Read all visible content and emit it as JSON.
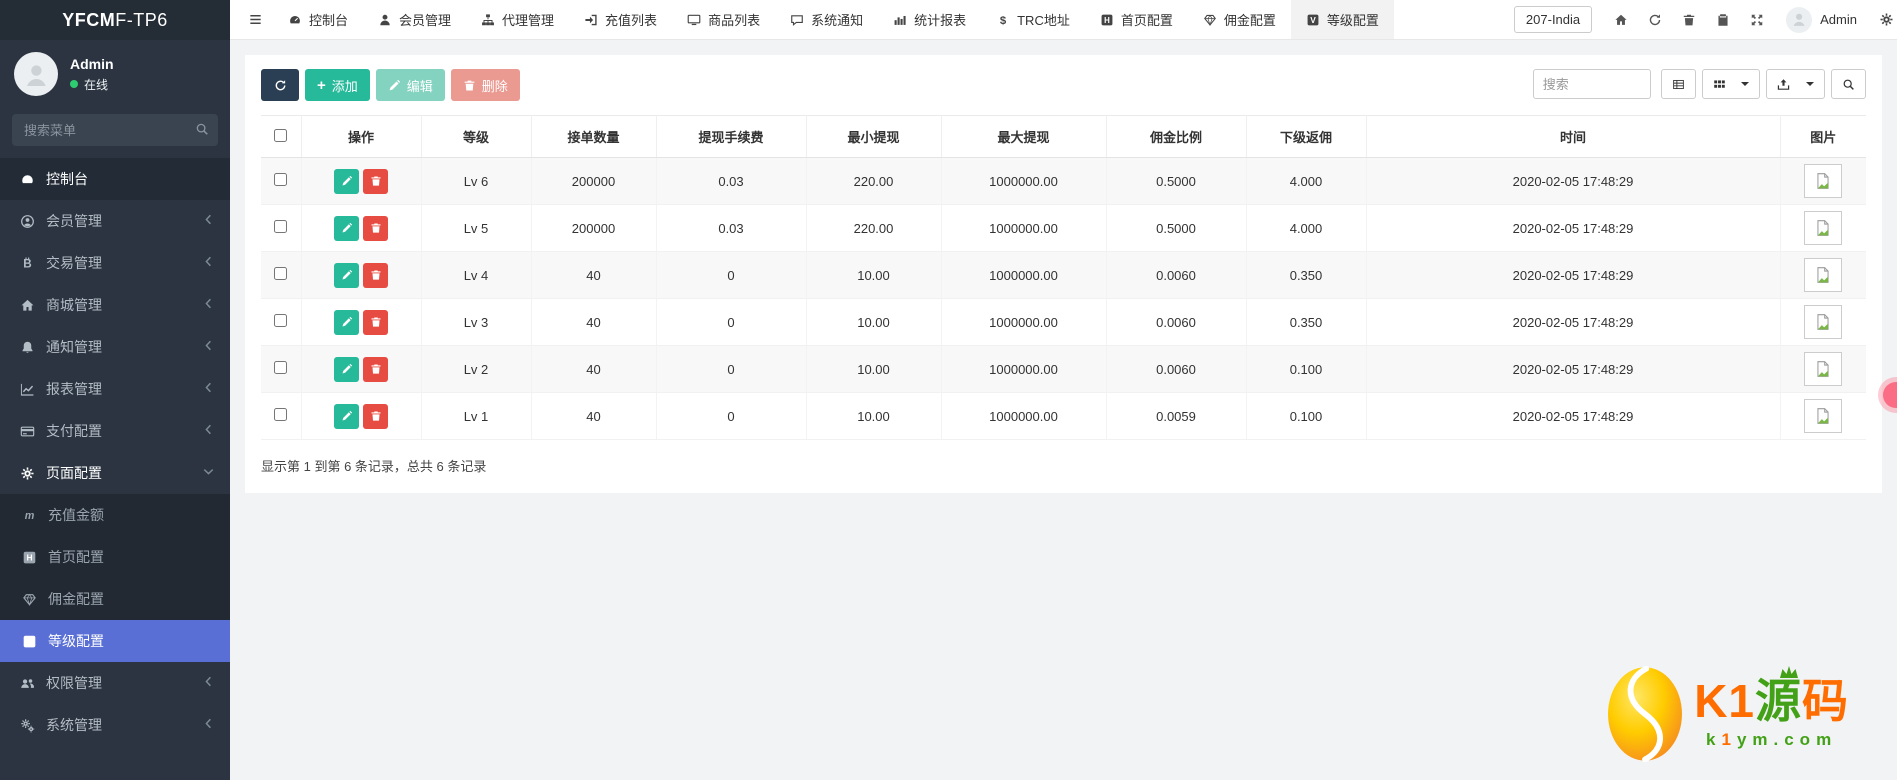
{
  "sidebar": {
    "logo_bold": "YFCM",
    "logo_light": "F-TP6",
    "user_name": "Admin",
    "user_status": "在线",
    "search_placeholder": "搜索菜单",
    "menu": [
      {
        "icon": "dashboard-icon",
        "label": "控制台",
        "state": "hover"
      },
      {
        "icon": "user-circle-icon",
        "label": "会员管理",
        "chevron": true
      },
      {
        "icon": "bitcoin-icon",
        "label": "交易管理",
        "chevron": true
      },
      {
        "icon": "home-icon",
        "label": "商城管理",
        "chevron": true
      },
      {
        "icon": "bell-icon",
        "label": "通知管理",
        "chevron": true
      },
      {
        "icon": "chart-line-icon",
        "label": "报表管理",
        "chevron": true
      },
      {
        "icon": "credit-card-icon",
        "label": "支付配置",
        "chevron": true
      },
      {
        "icon": "gear-icon",
        "label": "页面配置",
        "state": "open",
        "children": [
          {
            "icon": "monero-icon",
            "label": "充值金额"
          },
          {
            "icon": "h-square-icon",
            "label": "首页配置"
          },
          {
            "icon": "gem-icon",
            "label": "佣金配置"
          },
          {
            "icon": "v-square-icon",
            "label": "等级配置",
            "state": "active"
          }
        ]
      },
      {
        "icon": "users-icon",
        "label": "权限管理",
        "chevron": true
      },
      {
        "icon": "cogs-icon",
        "label": "系统管理",
        "chevron": true
      }
    ]
  },
  "navbar": {
    "tabs": [
      {
        "icon": "dashboard-icon",
        "label": "控制台"
      },
      {
        "icon": "user-icon",
        "label": "会员管理"
      },
      {
        "icon": "sitemap-icon",
        "label": "代理管理"
      },
      {
        "icon": "sign-in-icon",
        "label": "充值列表"
      },
      {
        "icon": "desktop-icon",
        "label": "商品列表"
      },
      {
        "icon": "comment-icon",
        "label": "系统通知"
      },
      {
        "icon": "bar-chart-icon",
        "label": "统计报表"
      },
      {
        "icon": "dollar-icon",
        "label": "TRC地址"
      },
      {
        "icon": "h-square-icon",
        "label": "首页配置"
      },
      {
        "icon": "gem-icon",
        "label": "佣金配置"
      },
      {
        "icon": "v-square-icon",
        "label": "等级配置",
        "active": true
      }
    ],
    "locale_label": "207-India",
    "right_icons": [
      "home-icon",
      "refresh-icon",
      "trash-icon",
      "copy-icon",
      "expand-icon"
    ],
    "user_name": "Admin"
  },
  "toolbar": {
    "add_label": "添加",
    "edit_label": "编辑",
    "delete_label": "删除",
    "search_placeholder": "搜索"
  },
  "table": {
    "columns": [
      "操作",
      "等级",
      "接单数量",
      "提现手续费",
      "最小提现",
      "最大提现",
      "佣金比例",
      "下级返佣",
      "时间",
      "图片"
    ],
    "rows": [
      {
        "level": "Lv 6",
        "orders": "200000",
        "fee": "0.03",
        "min": "220.00",
        "max": "1000000.00",
        "ratio": "0.5000",
        "sub": "4.000",
        "time": "2020-02-05 17:48:29"
      },
      {
        "level": "Lv 5",
        "orders": "200000",
        "fee": "0.03",
        "min": "220.00",
        "max": "1000000.00",
        "ratio": "0.5000",
        "sub": "4.000",
        "time": "2020-02-05 17:48:29"
      },
      {
        "level": "Lv 4",
        "orders": "40",
        "fee": "0",
        "min": "10.00",
        "max": "1000000.00",
        "ratio": "0.0060",
        "sub": "0.350",
        "time": "2020-02-05 17:48:29"
      },
      {
        "level": "Lv 3",
        "orders": "40",
        "fee": "0",
        "min": "10.00",
        "max": "1000000.00",
        "ratio": "0.0060",
        "sub": "0.350",
        "time": "2020-02-05 17:48:29"
      },
      {
        "level": "Lv 2",
        "orders": "40",
        "fee": "0",
        "min": "10.00",
        "max": "1000000.00",
        "ratio": "0.0060",
        "sub": "0.100",
        "time": "2020-02-05 17:48:29"
      },
      {
        "level": "Lv 1",
        "orders": "40",
        "fee": "0",
        "min": "10.00",
        "max": "1000000.00",
        "ratio": "0.0059",
        "sub": "0.100",
        "time": "2020-02-05 17:48:29"
      }
    ],
    "summary": "显示第 1 到第 6 条记录，总共 6 条记录"
  },
  "watermark": {
    "brand_part1": "K1",
    "brand_part2": "源",
    "brand_part3": "码",
    "domain_green_a": "k",
    "domain_orange": "1",
    "domain_green_b": "ym.com"
  },
  "colors": {
    "sidebar_bg": "#2b3440",
    "active_menu_blue": "#5a6fd6",
    "green": "#26b99a",
    "red": "#e64c42",
    "dark_button": "#2a3f54",
    "online_dot": "#2ecc71",
    "fab_pink": "#fb6d84",
    "watermark_orange": "#ff6d00",
    "watermark_green": "#43a117"
  }
}
